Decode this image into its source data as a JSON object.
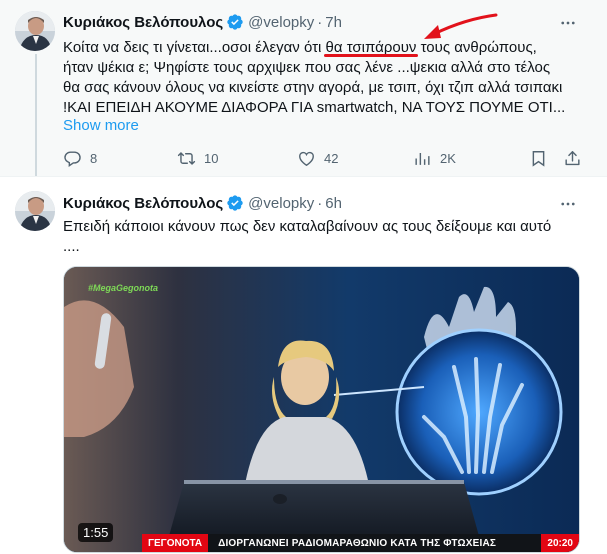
{
  "tweets": [
    {
      "author_name": "Κυριάκος Βελόπουλος",
      "handle": "@velopky",
      "time": "7h",
      "lines": [
        [
          "Κοίτα να δεις τι γίνεται...οσοι έλεγαν ότι ",
          "θα τσιπάρουν",
          " τους ανθρώπους,"
        ],
        [
          "ήταν ψέκια ε; Ψηφίστε τους αρχιψεκ που σας λένε ...ψεκια αλλά στο τέλος"
        ],
        [
          "θα σας κάνουν όλους να κινείστε στην αγορά, με τσιπ, όχι τζιπ αλλά τσιπακι"
        ],
        [
          "!ΚΑΙ ΕΠΕΙΔΗ ΑΚΟΥΜΕ ΔΙΑΦΟΡΑ ΓΙΑ smartwatch,  ΝΑ ΤΟΥΣ ΠΟΥΜΕ ΟΤΙ..."
        ]
      ],
      "show_more": "Show more",
      "stats": {
        "replies": "8",
        "reposts": "10",
        "likes": "42",
        "views": "2K"
      }
    },
    {
      "author_name": "Κυριάκος Βελόπουλος",
      "handle": "@velopky",
      "time": "6h",
      "lines": [
        [
          "Επειδή κάποιοι κάνουν πως δεν καταλαβαίνουν ας τους δείξουμε και αυτό"
        ],
        [
          "...."
        ]
      ],
      "video": {
        "duration": "1:55",
        "corner_logo": "#MegaGegonota",
        "ticker_brand": "ΓΕΓΟΝΟΤΑ",
        "ticker_headline": "ΔΙΟΡΓΑΝΩΝΕΙ ΡΑΔΙΟΜΑΡΑΘΩΝΙΟ ΚΑΤΑ ΤΗΣ ΦΤΩΧΕΙΑΣ",
        "ticker_clock": "20:20"
      }
    }
  ],
  "colors": {
    "accent": "#1d9bf0",
    "muted": "#536471",
    "highlight_underline": "#e2121b",
    "arrow": "#e2121b"
  },
  "icons": [
    "verified-badge-icon",
    "more-icon",
    "reply-icon",
    "repost-icon",
    "like-icon",
    "views-icon",
    "bookmark-icon",
    "share-icon"
  ]
}
